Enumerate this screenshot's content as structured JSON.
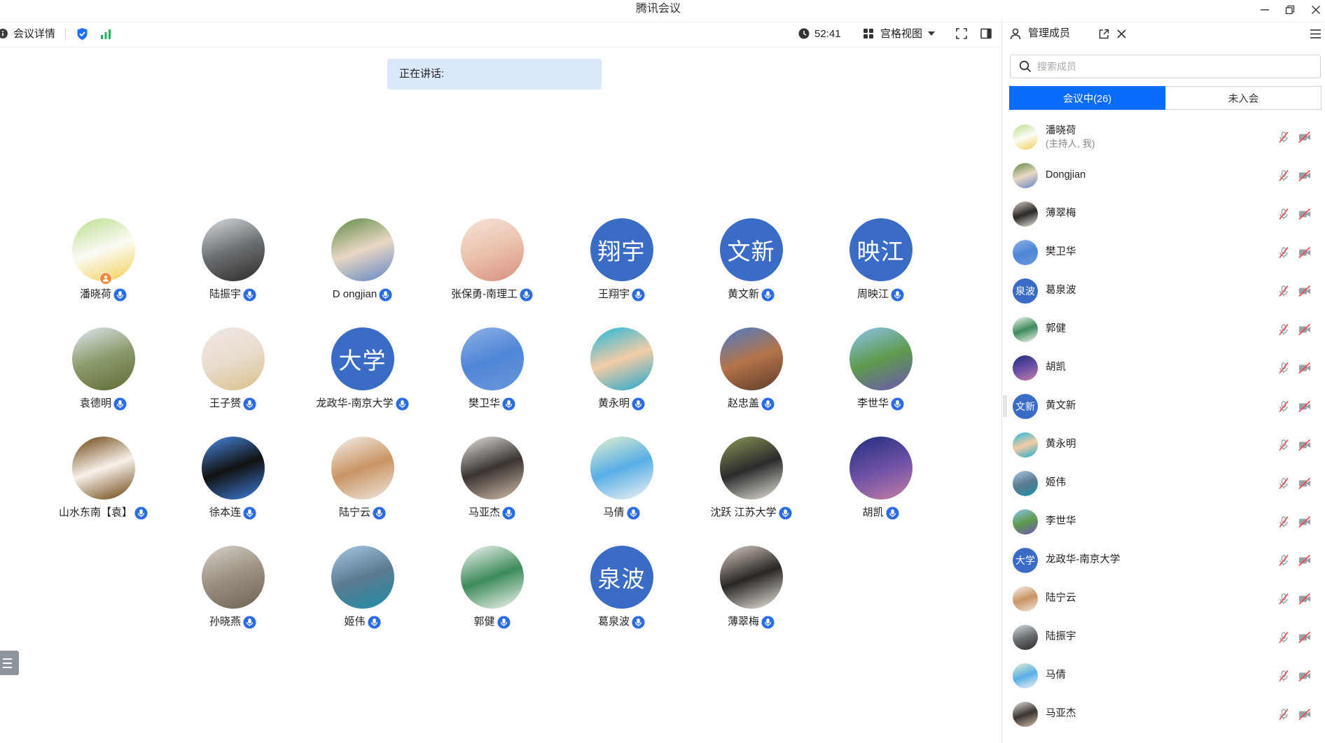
{
  "window": {
    "title": "腾讯会议",
    "controls": [
      "minimize-icon",
      "restore-icon",
      "close-icon"
    ]
  },
  "toolbar": {
    "meeting_info_label": "会议详情",
    "duration": "52:41",
    "view_mode_label": "宫格视图",
    "icons": [
      "info-icon",
      "shield-icon",
      "signal-icon",
      "clock-icon",
      "grid-view-icon",
      "dropdown-icon",
      "fullscreen-icon",
      "sidebar-toggle-icon"
    ]
  },
  "speaking": {
    "label": "正在讲话:"
  },
  "grid": {
    "participants": [
      {
        "name": "潘晓荷",
        "host": true,
        "avatar": {
          "colors": [
            "#b9de8c",
            "#fbfbf5",
            "#f2cf52"
          ]
        }
      },
      {
        "name": "陆振宇",
        "avatar": {
          "colors": [
            "#d7dde2",
            "#6b6f72",
            "#2d2a28"
          ]
        }
      },
      {
        "name": "D ongjian",
        "avatar": {
          "colors": [
            "#5f8a45",
            "#e9d7c4",
            "#5f86c4"
          ]
        }
      },
      {
        "name": "张保勇-南理工",
        "avatar": {
          "colors": [
            "#f7e3d8",
            "#eac2ad",
            "#d98f7e"
          ]
        }
      },
      {
        "name": "王翔宇",
        "avatar": {
          "text": "翔宇"
        }
      },
      {
        "name": "黄文新",
        "avatar": {
          "text": "文新"
        }
      },
      {
        "name": "周映江",
        "avatar": {
          "text": "映江"
        }
      },
      {
        "name": "袁德明",
        "avatar": {
          "colors": [
            "#dfe9f2",
            "#8a9a6a",
            "#5e6b35"
          ]
        }
      },
      {
        "name": "王子赟",
        "avatar": {
          "colors": [
            "#f0e8e6",
            "#e8dccd",
            "#d9c08a"
          ]
        }
      },
      {
        "name": "龙政华-南京大学",
        "avatar": {
          "text": "大学"
        }
      },
      {
        "name": "樊卫华",
        "avatar": {
          "colors": [
            "#8fb2e6",
            "#4f86d6",
            "#6a97dc"
          ]
        }
      },
      {
        "name": "黄永明",
        "avatar": {
          "colors": [
            "#20b8dc",
            "#f3cca6",
            "#1fa8cf"
          ]
        }
      },
      {
        "name": "赵忠盖",
        "avatar": {
          "colors": [
            "#4a7cc6",
            "#b5744a",
            "#5b3b2a"
          ]
        }
      },
      {
        "name": "李世华",
        "avatar": {
          "colors": [
            "#8cc4ec",
            "#5f9a4e",
            "#6c56b0"
          ]
        }
      },
      {
        "name": "山水东南【袁】",
        "avatar": {
          "colors": [
            "#6a3f0c",
            "#f7f2ea",
            "#6a3f0c"
          ]
        }
      },
      {
        "name": "徐本连",
        "avatar": {
          "colors": [
            "#4a8ae6",
            "#111111",
            "#3f7fdc"
          ]
        }
      },
      {
        "name": "陆宁云",
        "avatar": {
          "colors": [
            "#f6f2ec",
            "#c99465",
            "#f0e8de"
          ]
        }
      },
      {
        "name": "马亚杰",
        "avatar": {
          "colors": [
            "#e6e2de",
            "#3a3430",
            "#d4c0ae"
          ]
        }
      },
      {
        "name": "马倩",
        "avatar": {
          "colors": [
            "#e4f1cf",
            "#58aee6",
            "#f4f4f4"
          ]
        }
      },
      {
        "name": "沈跃 江苏大学",
        "avatar": {
          "colors": [
            "#8a9a58",
            "#2b2b2b",
            "#e9e6dc"
          ]
        }
      },
      {
        "name": "胡凯",
        "avatar": {
          "colors": [
            "#1f2f7a",
            "#6b4fa6",
            "#c47fa6"
          ]
        }
      },
      {
        "name": "孙晓燕",
        "avatar": {
          "colors": [
            "#d4d0c8",
            "#9a8f80",
            "#6e6253"
          ]
        }
      },
      {
        "name": "姬伟",
        "avatar": {
          "colors": [
            "#a8c8e6",
            "#5c7a8f",
            "#1e8fa8"
          ]
        }
      },
      {
        "name": "郭健",
        "avatar": {
          "colors": [
            "#f5f8f4",
            "#3d8a5a",
            "#f5f8f4"
          ]
        }
      },
      {
        "name": "葛泉波",
        "avatar": {
          "text": "泉波"
        }
      },
      {
        "name": "薄翠梅",
        "avatar": {
          "colors": [
            "#d9cfc6",
            "#2a2624",
            "#f0e9e2"
          ]
        }
      }
    ],
    "icons": {
      "participant_mic": "mic-icon",
      "host_badge": "host-icon"
    }
  },
  "sidebar": {
    "title": "管理成员",
    "search_placeholder": "搜索成员",
    "tabs": [
      {
        "label": "会议中(26)",
        "active": true
      },
      {
        "label": "未入会",
        "active": false
      }
    ],
    "icons": [
      "members-icon",
      "popout-icon",
      "close-icon",
      "menu-icon",
      "search-icon",
      "mic-off-icon",
      "video-off-icon"
    ],
    "members": [
      {
        "name": "潘晓荷",
        "role": "(主持人, 我)",
        "avatar": {
          "colors": [
            "#b9de8c",
            "#fbfbf5",
            "#f2cf52"
          ]
        }
      },
      {
        "name": "Dongjian",
        "avatar": {
          "colors": [
            "#5f8a45",
            "#e9d7c4",
            "#5f86c4"
          ]
        }
      },
      {
        "name": "薄翠梅",
        "avatar": {
          "colors": [
            "#d9cfc6",
            "#2a2624",
            "#f0e9e2"
          ]
        }
      },
      {
        "name": "樊卫华",
        "avatar": {
          "colors": [
            "#8fb2e6",
            "#4f86d6",
            "#6a97dc"
          ]
        }
      },
      {
        "name": "葛泉波",
        "avatar": {
          "text": "泉波"
        }
      },
      {
        "name": "郭健",
        "avatar": {
          "colors": [
            "#f5f8f4",
            "#3d8a5a",
            "#f5f8f4"
          ]
        }
      },
      {
        "name": "胡凯",
        "avatar": {
          "colors": [
            "#1f2f7a",
            "#6b4fa6",
            "#c47fa6"
          ]
        }
      },
      {
        "name": "黄文新",
        "avatar": {
          "text": "文新"
        }
      },
      {
        "name": "黄永明",
        "avatar": {
          "colors": [
            "#20b8dc",
            "#f3cca6",
            "#1fa8cf"
          ]
        }
      },
      {
        "name": "姬伟",
        "avatar": {
          "colors": [
            "#a8c8e6",
            "#5c7a8f",
            "#1e8fa8"
          ]
        }
      },
      {
        "name": "李世华",
        "avatar": {
          "colors": [
            "#8cc4ec",
            "#5f9a4e",
            "#6c56b0"
          ]
        }
      },
      {
        "name": "龙政华-南京大学",
        "avatar": {
          "text": "大学"
        }
      },
      {
        "name": "陆宁云",
        "avatar": {
          "colors": [
            "#f6f2ec",
            "#c99465",
            "#f0e8de"
          ]
        }
      },
      {
        "name": "陆振宇",
        "avatar": {
          "colors": [
            "#d7dde2",
            "#6b6f72",
            "#2d2a28"
          ]
        }
      },
      {
        "name": "马倩",
        "avatar": {
          "colors": [
            "#e4f1cf",
            "#58aee6",
            "#f4f4f4"
          ]
        }
      },
      {
        "name": "马亚杰",
        "avatar": {
          "colors": [
            "#e6e2de",
            "#3a3430",
            "#d4c0ae"
          ]
        }
      }
    ]
  },
  "colors": {
    "accent": "#0a6cff",
    "text_avatar_bg": "#3b6cc5",
    "speaking_bg": "#dbe8fb",
    "mic_blue": "#2b6be4",
    "muted_red": "#e5484d",
    "signal_green": "#20b35a",
    "host_badge": "#f08a3c"
  }
}
